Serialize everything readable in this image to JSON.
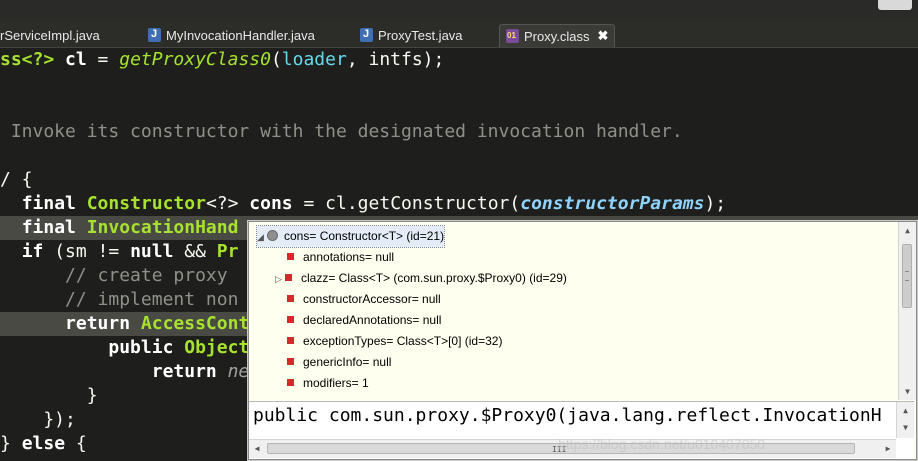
{
  "tabs": [
    {
      "label": "rServiceImpl.java",
      "icon": "none"
    },
    {
      "label": "MyInvocationHandler.java",
      "icon": "java-file-icon"
    },
    {
      "label": "ProxyTest.java",
      "icon": "java-file-icon"
    },
    {
      "label": "Proxy.class",
      "icon": "class-file-icon",
      "active": true,
      "close": "✖"
    }
  ],
  "code": {
    "l1": {
      "a": "ss<?> ",
      "b": "cl",
      "c": " = ",
      "d": "getProxyClass0",
      "e": "(",
      "f": "loader",
      "g": ", intfs);"
    },
    "l3": " Invoke its constructor with the designated invocation handler.",
    "l5": "/ {",
    "l6": {
      "a": "final ",
      "b": "Constructor",
      "c": "<?> ",
      "d": "cons",
      "e": " = cl.getConstructor(",
      "f": "constructorParams",
      "g": ");"
    },
    "l7": {
      "a": "final ",
      "b": "InvocationHand"
    },
    "l8": {
      "a": "if",
      "b": " (sm != ",
      "c": "null",
      "d": " && ",
      "e": "Pr"
    },
    "l9": "    // create proxy ",
    "l10": "    // implement non",
    "l11": {
      "a": "    return ",
      "b": "AccessCont"
    },
    "l12": {
      "a": "        public ",
      "b": "Object"
    },
    "l13": {
      "a": "            return ",
      "b": "ne"
    },
    "l14": "        }",
    "l15": "    });",
    "l16": {
      "a": "} ",
      "b": "else",
      "c": " {"
    }
  },
  "popup": {
    "rows": [
      {
        "toggle": "◢",
        "marker": "object",
        "text": "cons= Constructor<T>  (id=21)"
      },
      {
        "toggle": "",
        "marker": "field",
        "text": "annotations= null"
      },
      {
        "toggle": "▷",
        "marker": "field",
        "text": "clazz= Class<T> (com.sun.proxy.$Proxy0) (id=29)"
      },
      {
        "toggle": "",
        "marker": "field",
        "text": "constructorAccessor= null"
      },
      {
        "toggle": "",
        "marker": "field",
        "text": "declaredAnnotations= null"
      },
      {
        "toggle": "",
        "marker": "field",
        "text": "exceptionTypes= Class<T>[0]  (id=32)"
      },
      {
        "toggle": "",
        "marker": "field",
        "text": "genericInfo= null"
      },
      {
        "toggle": "",
        "marker": "field",
        "text": "modifiers= 1"
      }
    ],
    "detail": "public com.sun.proxy.$Proxy0(java.lang.reflect.InvocationH",
    "hgrip": "III"
  },
  "watermark": "https://blog.csdn.net/u010407050"
}
